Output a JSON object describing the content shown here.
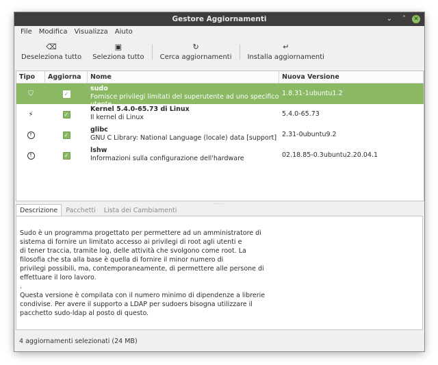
{
  "window": {
    "title": "Gestore Aggiornamenti",
    "controls": {
      "minimize": "⌄",
      "maximize": "˄",
      "close": "✕"
    }
  },
  "menu": [
    "File",
    "Modifica",
    "Visualizza",
    "Aiuto"
  ],
  "toolbar": [
    {
      "icon": "⌫",
      "label": "Deseleziona tutto"
    },
    {
      "icon": "▣",
      "label": "Seleziona tutto"
    },
    {
      "icon": "↻",
      "label": "Cerca aggiornamenti"
    },
    {
      "icon": "↵",
      "label": "Installa aggiornamenti"
    }
  ],
  "columns": {
    "type": "Tipo",
    "update": "Aggiorna",
    "name": "Nome",
    "version": "Nuova Versione"
  },
  "updates": [
    {
      "type_icon": "shield-icon",
      "glyph": "⛉",
      "checked": "✓",
      "name": "sudo",
      "description": "Fornisce privilegi limitati del superutente ad uno specifico utente",
      "version": "1.8.31-1ubuntu1.2",
      "selected": true
    },
    {
      "type_icon": "kernel-bolt-icon",
      "glyph": "⚡",
      "checked": "✓",
      "name": "Kernel 5.4.0-65.73 di Linux",
      "description": "Il kernel di Linux",
      "version": "5.4.0-65.73",
      "selected": false
    },
    {
      "type_icon": "upgrade-arrow-icon",
      "glyph": "↑",
      "checked": "✓",
      "name": "glibc",
      "description": "GNU C Library: National Language (locale) data [support]",
      "version": "2.31-0ubuntu9.2",
      "selected": false
    },
    {
      "type_icon": "upgrade-arrow-icon",
      "glyph": "↑",
      "checked": "✓",
      "name": "lshw",
      "description": "Informazioni sulla configurazione dell'hardware",
      "version": "02.18.85-0.3ubuntu2.20.04.1",
      "selected": false
    }
  ],
  "tabs": [
    "Descrizione",
    "Pacchetti",
    "Lista dei Cambiamenti"
  ],
  "description_lines": [
    "Sudo è un programma progettato per permettere ad un amministratore di",
    "sistema di fornire un limitato accesso ai privilegi di root agli utenti e",
    "di tener traccia, tramite log, delle attività che svolgono come root. La",
    "filosofia che sta alla base è quella di fornire il minor numero di",
    "privilegi possibili, ma, contemporaneamente, di permettere alle persone di",
    "effettuare il loro lavoro.",
    ".",
    "Questa versione è compilata con il numero minimo di dipendenze a librerie",
    "condivise. Per avere il supporto a LDAP per sudoers bisogna utilizzare il",
    "pacchetto sudo-ldap al posto di questo."
  ],
  "status": "4 aggiornamenti selezionati (24 MB)",
  "colors": {
    "accent": "#8ab863",
    "titlebar": "#3d3d3d"
  }
}
